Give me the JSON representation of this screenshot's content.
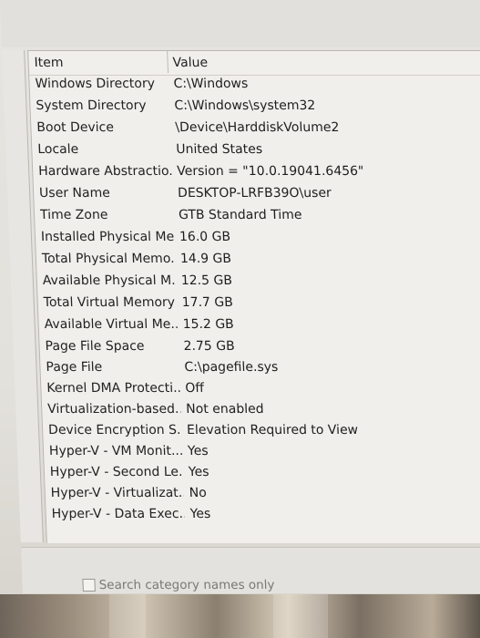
{
  "table": {
    "columns": {
      "item": "Item",
      "value": "Value"
    },
    "rows": [
      {
        "item": "Windows Directory",
        "value": "C:\\Windows"
      },
      {
        "item": "System Directory",
        "value": "C:\\Windows\\system32"
      },
      {
        "item": "Boot Device",
        "value": "\\Device\\HarddiskVolume2"
      },
      {
        "item": "Locale",
        "value": "United States"
      },
      {
        "item": "Hardware Abstractio...",
        "value": "Version = \"10.0.19041.6456\""
      },
      {
        "item": "User Name",
        "value": "DESKTOP-LRFB39O\\user"
      },
      {
        "item": "Time Zone",
        "value": "GTB Standard Time"
      },
      {
        "item": "Installed Physical Me...",
        "value": "16.0 GB"
      },
      {
        "item": "Total Physical Memo...",
        "value": "14.9 GB"
      },
      {
        "item": "Available Physical M...",
        "value": "12.5 GB"
      },
      {
        "item": "Total Virtual Memory",
        "value": "17.7 GB"
      },
      {
        "item": "Available Virtual Me...",
        "value": "15.2 GB"
      },
      {
        "item": "Page File Space",
        "value": "2.75 GB"
      },
      {
        "item": "Page File",
        "value": "C:\\pagefile.sys"
      },
      {
        "item": "Kernel DMA Protecti...",
        "value": "Off"
      },
      {
        "item": "Virtualization-based...",
        "value": "Not enabled"
      },
      {
        "item": "Device Encryption S...",
        "value": "Elevation Required to View"
      },
      {
        "item": "Hyper-V - VM Monit...",
        "value": "Yes"
      },
      {
        "item": "Hyper-V - Second Le...",
        "value": "Yes"
      },
      {
        "item": "Hyper-V - Virtualizat...",
        "value": "No"
      },
      {
        "item": "Hyper-V - Data Exec...",
        "value": "Yes"
      }
    ]
  },
  "footer": {
    "search_category_label": "Search category names only",
    "search_category_checked": false
  }
}
